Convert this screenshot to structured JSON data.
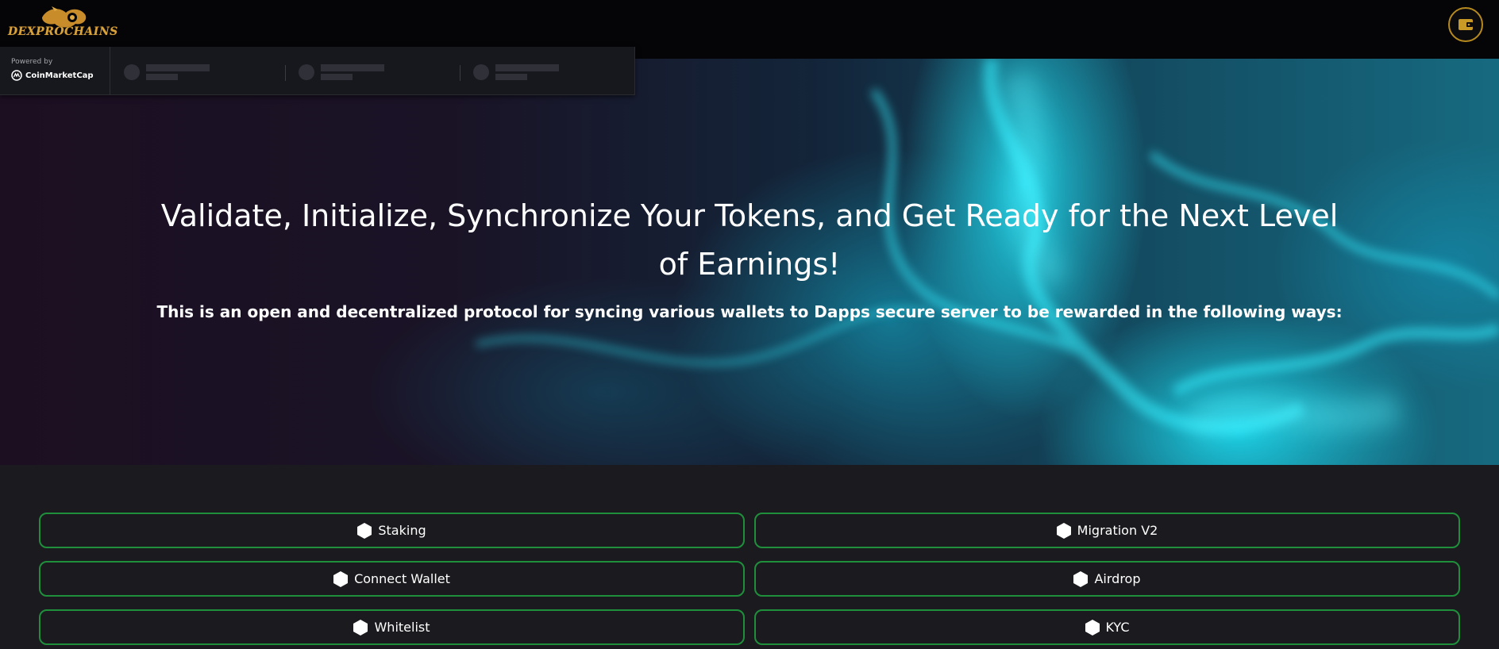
{
  "header": {
    "logo_text": "DEXPROCHAINS",
    "logo_icon": "dragon-icon",
    "wallet_icon": "wallet-icon",
    "accent": "#b68a1f"
  },
  "ticker": {
    "powered_by": "Powered by",
    "provider": "CoinMarketCap",
    "items": [
      {},
      {},
      {}
    ]
  },
  "hero": {
    "title": "Validate, Initialize, Synchronize Your Tokens, and Get Ready for the Next Level of Earnings!",
    "subtitle": "This is an open and decentralized protocol for syncing various wallets to Dapps secure server to be rewarded in the following ways:"
  },
  "options": [
    {
      "label": "Staking",
      "icon": "hexagon-icon"
    },
    {
      "label": "Migration V2",
      "icon": "hexagon-icon"
    },
    {
      "label": "Connect Wallet",
      "icon": "hexagon-icon"
    },
    {
      "label": "Airdrop",
      "icon": "hexagon-icon"
    },
    {
      "label": "Whitelist",
      "icon": "hexagon-icon"
    },
    {
      "label": "KYC",
      "icon": "hexagon-icon"
    }
  ],
  "colors": {
    "option_border": "#1f8f3c",
    "background": "#1b1b1f",
    "hero_glow": "#23e6fa"
  }
}
